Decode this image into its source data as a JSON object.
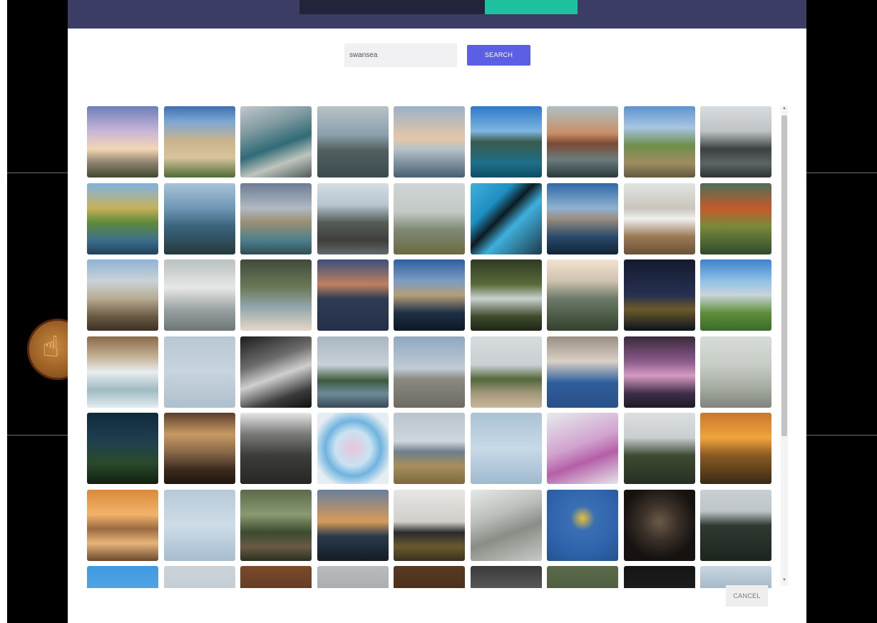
{
  "tabs": [
    {
      "label": "",
      "active": false
    },
    {
      "label": "",
      "active": false
    },
    {
      "label": "",
      "active": true
    }
  ],
  "search": {
    "value": "swansea",
    "button_label": "SEARCH"
  },
  "cancel_label": "CANCEL",
  "background_icon": "hand-pointer-icon",
  "photos": [
    {
      "name": "sunset-clouds-coast",
      "gradient": "linear-gradient(180deg,#6d7fb8 0%,#c9b5d8 35%,#f3d6b2 60%,#8a7f6c 80%,#3f4a2c 100%)"
    },
    {
      "name": "sandy-beach-bay",
      "gradient": "linear-gradient(180deg,#3f6fb0 0%,#7ea7d4 22%,#c9b38c 48%,#d8c49c 72%,#4f6a35 100%)"
    },
    {
      "name": "marina-aerial",
      "gradient": "linear-gradient(160deg,#bfc7cc 0%,#7f9aa0 30%,#2f6b77 55%,#c0c4bd 75%,#4d5b59 100%)"
    },
    {
      "name": "lighthouse-island",
      "gradient": "linear-gradient(180deg,#b8c2c8 0%,#8aa0ad 40%,#52605f 62%,#3a4a4f 100%)"
    },
    {
      "name": "pier-dusk",
      "gradient": "linear-gradient(180deg,#9bb1c7 0%,#e6c6a8 45%,#b6c2c9 60%,#475f72 100%)"
    },
    {
      "name": "blue-harbour",
      "gradient": "linear-gradient(180deg,#2e78c8 0%,#7fb6e2 35%,#3a5a4c 50%,#1d6f8a 80%,#0f4b63 100%)"
    },
    {
      "name": "brick-chimney-reflection",
      "gradient": "linear-gradient(180deg,#aebfc4 0%,#c98f67 38%,#7b4a35 52%,#6b7b7c 75%,#2a3a3c 100%)"
    },
    {
      "name": "coastal-hills",
      "gradient": "linear-gradient(180deg,#5f93cf 0%,#a7c5e2 30%,#6f8f4a 55%,#a08c62 80%,#5f5a3c 100%)"
    },
    {
      "name": "rocky-shore",
      "gradient": "linear-gradient(180deg,#d9dcde 0%,#bfc3c6 35%,#3b4040 60%,#5d6466 80%,#2e3333 100%)"
    },
    {
      "name": "autumn-lake",
      "gradient": "linear-gradient(180deg,#7fb3e2 0%,#c7b15a 35%,#5f8a3b 55%,#3c6f8c 80%,#21405a 100%)"
    },
    {
      "name": "island-cliff",
      "gradient": "linear-gradient(180deg,#a9c3d8 0%,#6f97b6 35%,#3b657d 60%,#25383c 100%)"
    },
    {
      "name": "stone-tower",
      "gradient": "linear-gradient(180deg,#6c7d94 0%,#b1b9c3 35%,#9a8f73 55%,#4c7f8c 80%,#2f4c54 100%)"
    },
    {
      "name": "rocky-headland",
      "gradient": "linear-gradient(180deg,#d5dde2 0%,#b7c6d1 30%,#555d57 55%,#3f3e3a 80%,#636a6c 100%)"
    },
    {
      "name": "misty-coast",
      "gradient": "linear-gradient(180deg,#cfd5d6 0%,#c4c9c6 40%,#7e8a76 65%,#6a6a3f 100%)"
    },
    {
      "name": "dancers-mural",
      "gradient": "linear-gradient(135deg,#3fb0dc 0%,#1e8fc1 30%,#0e1a20 45%,#3fb0dc 60%,#1d3a48 100%)"
    },
    {
      "name": "harbour-boats",
      "gradient": "linear-gradient(180deg,#2f6aa8 0%,#8fb1cf 35%,#9a8c80 50%,#2a4a6a 75%,#0f2338 100%)"
    },
    {
      "name": "ponies-moor",
      "gradient": "linear-gradient(180deg,#e2e4e2 0%,#c9c5bd 35%,#f0f0ee 50%,#9a7a55 75%,#6a5238 100%)"
    },
    {
      "name": "autumn-forest",
      "gradient": "linear-gradient(180deg,#4d6f5a 0%,#c45a2a 35%,#7a8a3c 60%,#2f4a2c 100%)"
    },
    {
      "name": "girl-with-ponies",
      "gradient": "linear-gradient(180deg,#8fb2d3 0%,#c9d3d8 30%,#b7ab92 55%,#6a5a44 80%,#3c3124 100%)"
    },
    {
      "name": "swans",
      "gradient": "linear-gradient(180deg,#b9c0c1 0%,#e6e8e6 40%,#9aa3a4 70%,#6d7577 100%)"
    },
    {
      "name": "ice-cream-cup",
      "gradient": "linear-gradient(180deg,#3f4b3a 0%,#6d7a58 40%,#8da3a8 65%,#e6d7c8 100%)"
    },
    {
      "name": "bridge-dusk",
      "gradient": "linear-gradient(180deg,#3a4f7a 0%,#c08060 35%,#2f3c55 55%,#243049 100%)"
    },
    {
      "name": "marina-night",
      "gradient": "linear-gradient(180deg,#2e5fa0 0%,#7c9cc2 30%,#b59e78 50%,#1d3046 75%,#0d1824 100%)"
    },
    {
      "name": "waterfall",
      "gradient": "linear-gradient(180deg,#2f3a24 0%,#5a6a38 35%,#c9d2cf 55%,#3f4a2c 80%,#1e2616 100%)"
    },
    {
      "name": "cliff-steps",
      "gradient": "linear-gradient(180deg,#f3e2cf 0%,#d0c2b0 30%,#6d7a6a 55%,#4a5a44 80%,#36402f 100%)"
    },
    {
      "name": "city-lights-night",
      "gradient": "linear-gradient(180deg,#141a30 0%,#26304f 50%,#6b5a2a 70%,#0d1220 100%)"
    },
    {
      "name": "green-bay",
      "gradient": "linear-gradient(180deg,#3f83c8 0%,#8fc0e8 30%,#c9d4d9 50%,#5f8f3a 75%,#3a6a2a 100%)"
    },
    {
      "name": "waves-shore",
      "gradient": "linear-gradient(180deg,#8a6a48 0%,#c7b59a 30%,#e8eef0 50%,#9fbac2 75%,#e2ecef 100%)"
    },
    {
      "name": "red-arrows-formation",
      "gradient": "linear-gradient(180deg,#b9c8d6 0%,#c8d4de 50%,#aebfcd 100%)"
    },
    {
      "name": "bw-waves",
      "gradient": "linear-gradient(160deg,#1c1c1c 0%,#6d6d6d 35%,#cfcfcf 55%,#3a3a3a 80%,#101010 100%)"
    },
    {
      "name": "lighthouse-mumbles",
      "gradient": "linear-gradient(180deg,#a9b6c2 0%,#c9d1d7 40%,#3d5a3c 62%,#6d8a9a 80%,#384a55 100%)"
    },
    {
      "name": "beach-walker",
      "gradient": "linear-gradient(180deg,#8fa8c2 0%,#bfcbd4 45%,#8a8a80 60%,#6d6a63 100%)"
    },
    {
      "name": "green-headland",
      "gradient": "linear-gradient(180deg,#d7dcde 0%,#c9cfd2 40%,#52683a 60%,#a3987d 80%,#c9b89a 100%)"
    },
    {
      "name": "old-man-portrait",
      "gradient": "linear-gradient(180deg,#9a8f84 0%,#d9d0c6 35%,#2f5e9c 65%,#2a4f86 100%)"
    },
    {
      "name": "purple-sunset",
      "gradient": "linear-gradient(180deg,#3a2a3a 0%,#8a5a8a 35%,#d69ac2 55%,#3f2f48 80%,#1f1a26 100%)"
    },
    {
      "name": "swan-pond",
      "gradient": "linear-gradient(180deg,#d7dcd8 0%,#c7ccc6 40%,#a9aea4 70%,#7f857c 100%)"
    },
    {
      "name": "milky-way-forest",
      "gradient": "linear-gradient(180deg,#0f2a3c 0%,#1f3f4f 40%,#2a4a2c 70%,#10210f 100%)"
    },
    {
      "name": "railway-station",
      "gradient": "linear-gradient(180deg,#5a3f2c 0%,#c89a62 30%,#8a6a4a 55%,#3c2a1e 80%,#201610 100%)"
    },
    {
      "name": "rock-face",
      "gradient": "linear-gradient(180deg,#e5e6e6 0%,#7a7b78 30%,#3c3d3a 60%,#262724 100%)"
    },
    {
      "name": "smoke-trails-blue",
      "gradient": "radial-gradient(circle at 50% 50%,#e9c3dc 0%,#c9e3f2 35%,#6fb3df 55%,#e7eef3 80%)"
    },
    {
      "name": "wedding-beach",
      "gradient": "linear-gradient(180deg,#b9c4ce 0%,#cfd6dc 40%,#6f7f8a 55%,#a88e5a 75%,#7a6a3f 100%)"
    },
    {
      "name": "jets-diving",
      "gradient": "linear-gradient(180deg,#a9c3d6 0%,#c9d9e6 50%,#9fbad0 100%)"
    },
    {
      "name": "red-arrows-pink-smoke",
      "gradient": "linear-gradient(160deg,#e6ebee 0%,#d1a3cf 45%,#b55fa8 65%,#e3e7ea 100%)"
    },
    {
      "name": "hilltop-lighthouse",
      "gradient": "linear-gradient(180deg,#dcdfe0 0%,#c9ced0 35%,#3e4a32 60%,#262f22 100%)"
    },
    {
      "name": "golden-sunset-rocks",
      "gradient": "linear-gradient(180deg,#c9782c 0%,#f0a43e 35%,#8a5a22 60%,#3a2a16 100%)"
    },
    {
      "name": "orange-horizon",
      "gradient": "linear-gradient(180deg,#d98a3c 0%,#f2b36a 35%,#9a6a42 55%,#e8b47a 75%,#6a4a2e 100%)"
    },
    {
      "name": "jets-sky",
      "gradient": "linear-gradient(180deg,#b7c9d8 0%,#cddce7 50%,#a7bccf 100%)"
    },
    {
      "name": "bird-in-tree",
      "gradient": "linear-gradient(180deg,#5a6a4a 0%,#8a9a72 35%,#3c4a2e 60%,#6a5a44 80%,#2a3020 100%)"
    },
    {
      "name": "sea-sunset",
      "gradient": "linear-gradient(180deg,#6a7f9a 0%,#d89a5a 45%,#2a3a4c 65%,#141c26 100%)"
    },
    {
      "name": "photographer-rock",
      "gradient": "linear-gradient(180deg,#e6e6e4 0%,#d0cfc9 45%,#2a2a2e 60%,#6a5a2c 80%,#3a3020 100%)"
    },
    {
      "name": "sea-wall-curve",
      "gradient": "linear-gradient(160deg,#e6e8e6 0%,#bdbfbc 35%,#8a8c86 60%,#c8cac5 100%)"
    },
    {
      "name": "hot-air-balloon",
      "gradient": "radial-gradient(circle at 50% 40%,#e6c23a 0%,#3a6fb3 22%,#2f64ac 60%,#24528f 100%)"
    },
    {
      "name": "skull-dark",
      "gradient": "radial-gradient(circle at 50% 45%,#6a5a48 0%,#3a3028 35%,#151210 70%)"
    },
    {
      "name": "dark-forest",
      "gradient": "linear-gradient(180deg,#c9cfd2 0%,#bfc6c9 30%,#2f3a32 50%,#1c241e 100%)"
    },
    {
      "name": "blue-sky-partial",
      "gradient": "linear-gradient(180deg,#3f9ae0 0%,#78b8e8 100%)"
    },
    {
      "name": "grey-sky-partial",
      "gradient": "linear-gradient(180deg,#c9d3d9 0%,#b8c2c8 100%)"
    },
    {
      "name": "interior-partial",
      "gradient": "linear-gradient(180deg,#7a4a2c 0%,#3a2216 100%)"
    },
    {
      "name": "waves-partial",
      "gradient": "linear-gradient(180deg,#b8bcbe 0%,#8a9092 100%)"
    },
    {
      "name": "bar-interior-partial",
      "gradient": "linear-gradient(180deg,#5a3a22 0%,#2a1a10 100%)"
    },
    {
      "name": "bw-crowd-partial",
      "gradient": "linear-gradient(180deg,#3a3a3a 0%,#9a9a9a 100%)"
    },
    {
      "name": "tree-partial",
      "gradient": "linear-gradient(180deg,#5a6a4a 0%,#3a4a2e 100%)"
    },
    {
      "name": "dark-partial",
      "gradient": "linear-gradient(180deg,#151515 0%,#2a2a2a 100%)"
    },
    {
      "name": "coast-partial",
      "gradient": "linear-gradient(180deg,#c9d6e0 0%,#5a7a9a 100%)"
    }
  ]
}
